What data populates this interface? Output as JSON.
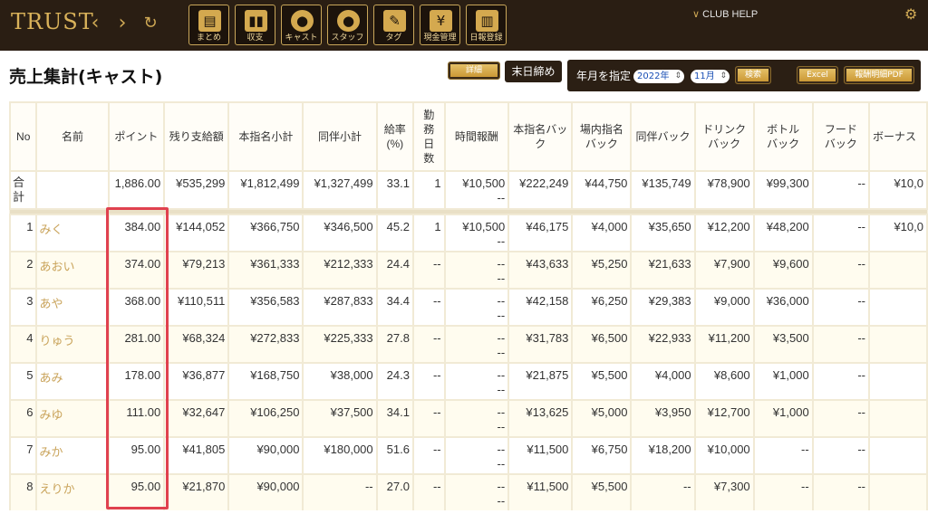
{
  "app": {
    "logo": "TRUST",
    "back_icon": "‹",
    "forward_icon": "›",
    "reload_icon": "↻",
    "help_label": "CLUB HELP",
    "accent": "#d4a94f"
  },
  "toolbar": [
    {
      "label": "まとめ",
      "icon": "clipboard-icon",
      "glyph": "📋"
    },
    {
      "label": "収支",
      "icon": "bar-chart-icon",
      "glyph": "▮"
    },
    {
      "label": "キャスト",
      "icon": "cast-person-icon",
      "glyph": "●"
    },
    {
      "label": "スタッフ",
      "icon": "staff-person-icon",
      "glyph": "●"
    },
    {
      "label": "タグ",
      "icon": "tag-icon",
      "glyph": "✎"
    },
    {
      "label": "現金管理",
      "icon": "cash-icon",
      "glyph": "¥"
    },
    {
      "label": "日報登録",
      "icon": "daily-report-icon",
      "glyph": "▤"
    }
  ],
  "page": {
    "title": "売上集計(キャスト)",
    "detail_button": "詳細",
    "closing_button": "末日締め",
    "filter_label": "年月を指定",
    "year_value": "2022年",
    "month_value": "11月",
    "search_button": "検索",
    "excel_button": "Excel",
    "pdf_button": "報酬明細PDF"
  },
  "table": {
    "headers": [
      "No",
      "名前",
      "ポイント",
      "残り支給額",
      "本指名小計",
      "同伴小計",
      "給率\n(%)",
      "勤\n務\n日\n数",
      "時間報酬",
      "本指名バッ\nク",
      "場内指名\nバック",
      "同伴バック",
      "ドリンク\nバック",
      "ボトル\nバック",
      "フード\nバック",
      "ボーナス"
    ],
    "total": {
      "label": "合\n計",
      "cells": [
        "",
        "1,886.00",
        "¥535,299",
        "¥1,812,499",
        "¥1,327,499",
        "33.1",
        "1",
        "¥10,500\n--",
        "¥222,249",
        "¥44,750",
        "¥135,749",
        "¥78,900",
        "¥99,300",
        "--",
        "¥10,0"
      ]
    },
    "rows": [
      {
        "no": "1",
        "name": "みく",
        "cells": [
          "384.00",
          "¥144,052",
          "¥366,750",
          "¥346,500",
          "45.2",
          "1",
          "¥10,500\n--",
          "¥46,175",
          "¥4,000",
          "¥35,650",
          "¥12,200",
          "¥48,200",
          "--",
          "¥10,0"
        ]
      },
      {
        "no": "2",
        "name": "あおい",
        "cells": [
          "374.00",
          "¥79,213",
          "¥361,333",
          "¥212,333",
          "24.4",
          "--",
          "--\n--",
          "¥43,633",
          "¥5,250",
          "¥21,633",
          "¥7,900",
          "¥9,600",
          "--",
          ""
        ]
      },
      {
        "no": "3",
        "name": "あや",
        "cells": [
          "368.00",
          "¥110,511",
          "¥356,583",
          "¥287,833",
          "34.4",
          "--",
          "--\n--",
          "¥42,158",
          "¥6,250",
          "¥29,383",
          "¥9,000",
          "¥36,000",
          "--",
          ""
        ]
      },
      {
        "no": "4",
        "name": "りゅう",
        "cells": [
          "281.00",
          "¥68,324",
          "¥272,833",
          "¥225,333",
          "27.8",
          "--",
          "--\n--",
          "¥31,783",
          "¥6,500",
          "¥22,933",
          "¥11,200",
          "¥3,500",
          "--",
          ""
        ]
      },
      {
        "no": "5",
        "name": "あみ",
        "cells": [
          "178.00",
          "¥36,877",
          "¥168,750",
          "¥38,000",
          "24.3",
          "--",
          "--\n--",
          "¥21,875",
          "¥5,500",
          "¥4,000",
          "¥8,600",
          "¥1,000",
          "--",
          ""
        ]
      },
      {
        "no": "6",
        "name": "みゆ",
        "cells": [
          "111.00",
          "¥32,647",
          "¥106,250",
          "¥37,500",
          "34.1",
          "--",
          "--\n--",
          "¥13,625",
          "¥5,000",
          "¥3,950",
          "¥12,700",
          "¥1,000",
          "--",
          ""
        ]
      },
      {
        "no": "7",
        "name": "みか",
        "cells": [
          "95.00",
          "¥41,805",
          "¥90,000",
          "¥180,000",
          "51.6",
          "--",
          "--\n--",
          "¥11,500",
          "¥6,750",
          "¥18,200",
          "¥10,000",
          "--",
          "--",
          ""
        ]
      },
      {
        "no": "8",
        "name": "えりか",
        "cells": [
          "95.00",
          "¥21,870",
          "¥90,000",
          "--",
          "27.0",
          "--",
          "--\n--",
          "¥11,500",
          "¥5,500",
          "--",
          "¥7,300",
          "--",
          "--",
          ""
        ]
      }
    ]
  }
}
